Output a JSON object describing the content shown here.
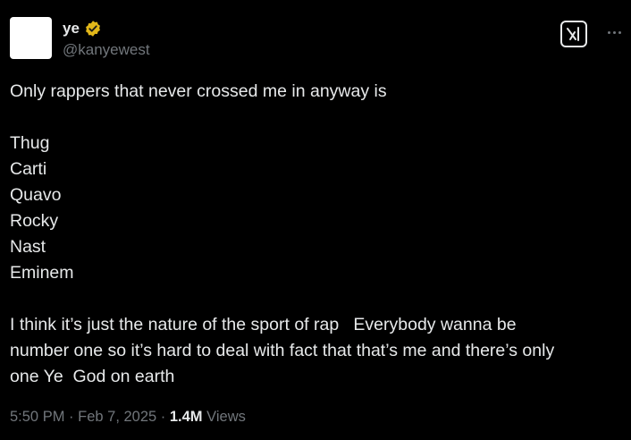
{
  "author": {
    "display_name": "ye",
    "handle": "@kanyewest",
    "verified_badge_color": "#e2b719"
  },
  "tweet": {
    "lines": [
      "Only rappers that never crossed me in anyway is",
      "",
      "Thug",
      "Carti",
      "Quavo",
      "Rocky",
      "Nast",
      "Eminem",
      "",
      "I think it’s just the nature of the sport of rap   Everybody wanna be",
      "number one so it’s hard to deal with fact that that’s me and there’s only",
      "one Ye  God on earth"
    ]
  },
  "meta": {
    "time": "5:50 PM",
    "separator1": " · ",
    "date": "Feb 7, 2025",
    "separator2": " · ",
    "views_count": "1.4M",
    "views_label": " Views"
  },
  "icons": {
    "grok": "grok-icon",
    "more": "more-icon",
    "verified": "verified-badge-icon"
  },
  "colors": {
    "background": "#000000",
    "text": "#e7e9ea",
    "secondary": "#71767b"
  }
}
